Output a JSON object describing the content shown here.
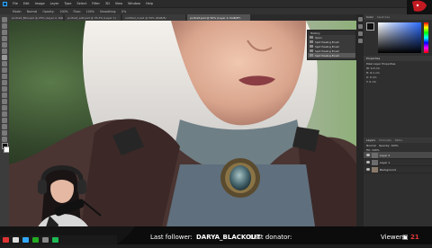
{
  "app": {
    "name": "Photoshop"
  },
  "menu": [
    "File",
    "Edit",
    "Image",
    "Layer",
    "Type",
    "Select",
    "Filter",
    "3D",
    "View",
    "Window",
    "Help"
  ],
  "options_bar": [
    "Mode:",
    "Normal",
    "Opacity:",
    "100%",
    "Flow:",
    "100%",
    "Smoothing:",
    "0%"
  ],
  "tabs": [
    {
      "label": "portrait_B2A.psd @ 25% (Layer 2, RGB/8)",
      "active": false
    },
    {
      "label": "portrait_edit.psd @ 33.3% (Layer 1)",
      "active": false
    },
    {
      "label": "untitled_2.psd @ 50% (RGB/8)",
      "active": false
    },
    {
      "label": "portrait.psd @ 50% (Layer 2, RGB/8*)",
      "active": true
    }
  ],
  "history": {
    "title": "History",
    "items": [
      "Open",
      "Spot Healing Brush",
      "Spot Healing Brush",
      "Spot Healing Brush",
      "Spot Healing Brush"
    ]
  },
  "color_panel": {
    "tab": "Color",
    "tab2": "Swatches",
    "hue_color": "#2b6bff"
  },
  "properties": {
    "tab": "Properties",
    "title": "Pixel Layer Properties",
    "rows": [
      "W: 4,3 cm",
      "H: 6,1 cm",
      "X: 0 cm",
      "Y: 0 cm"
    ]
  },
  "layers_panel": {
    "tabs": [
      "Layers",
      "Channels",
      "Paths"
    ],
    "blend_mode": "Normal",
    "opacity": "Opacity: 100%",
    "fill": "Fill: 100%",
    "layers": [
      {
        "name": "Layer 2",
        "selected": true
      },
      {
        "name": "Layer 1",
        "selected": false
      },
      {
        "name": "Background",
        "selected": false
      }
    ]
  },
  "stream": {
    "follower_label": "Last follower:",
    "follower_name": "DARYA_BLACKOUT",
    "donator_label": "Last donator:",
    "donator_name": "",
    "viewers_label": "Viewers:",
    "viewers_count": "21"
  }
}
